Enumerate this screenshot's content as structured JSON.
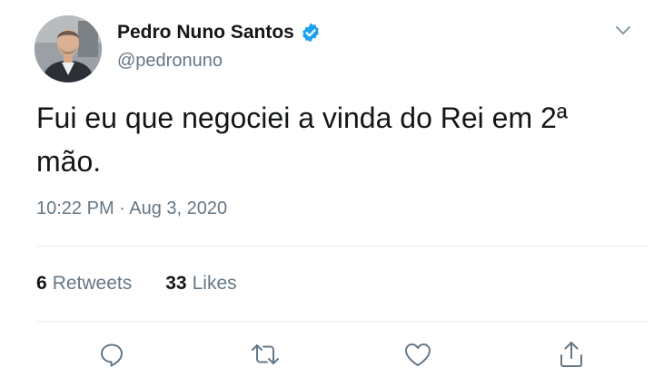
{
  "author": {
    "display_name": "Pedro Nuno Santos",
    "handle": "@pedronuno",
    "verified": true,
    "verified_color": "#1da1f2"
  },
  "tweet": {
    "text": "Fui eu que negociei a vinda do Rei em 2ª mão.",
    "timestamp": "10:22 PM · Aug 3, 2020"
  },
  "stats": {
    "retweets_count": "6",
    "retweets_label": "Retweets",
    "likes_count": "33",
    "likes_label": "Likes"
  },
  "actions": [
    {
      "name": "reply",
      "icon": "speech-bubble-icon"
    },
    {
      "name": "retweet",
      "icon": "retweet-arrows-icon"
    },
    {
      "name": "like",
      "icon": "heart-icon"
    },
    {
      "name": "share",
      "icon": "share-upload-icon"
    }
  ],
  "colors": {
    "text_primary": "#14171a",
    "text_secondary": "#657786",
    "divider": "#e6ecf0",
    "accent": "#1da1f2"
  }
}
